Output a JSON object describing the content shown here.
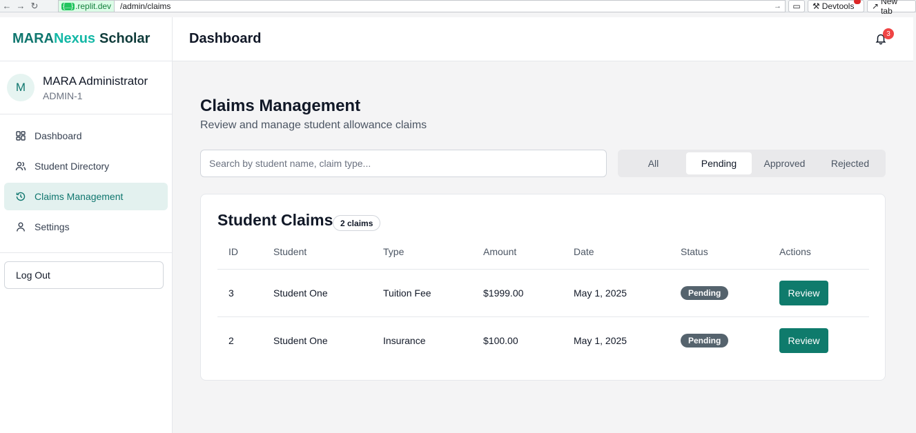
{
  "browser": {
    "host_badge": "{...}",
    "host": ".replit.dev",
    "path": "/admin/claims",
    "devtools_label": "Devtools",
    "new_tab_label": "New tab"
  },
  "sidebar": {
    "brand_part1": "MARA",
    "brand_part2": "Nexus",
    "brand_part3": "Scholar",
    "user": {
      "initial": "M",
      "name": "MARA Administrator",
      "id": "ADMIN-1"
    },
    "items": [
      {
        "label": "Dashboard",
        "icon": "dashboard-icon"
      },
      {
        "label": "Student Directory",
        "icon": "users-icon"
      },
      {
        "label": "Claims Management",
        "icon": "history-icon",
        "active": true
      },
      {
        "label": "Settings",
        "icon": "user-icon"
      }
    ],
    "logout_label": "Log Out"
  },
  "header": {
    "title": "Dashboard",
    "notification_count": "3"
  },
  "main": {
    "title": "Claims Management",
    "subtitle": "Review and manage student allowance claims",
    "search_placeholder": "Search by student name, claim type...",
    "filters": [
      {
        "label": "All"
      },
      {
        "label": "Pending",
        "active": true
      },
      {
        "label": "Approved"
      },
      {
        "label": "Rejected"
      }
    ],
    "card": {
      "title": "Student Claims",
      "count_badge": "2 claims",
      "columns": [
        "ID",
        "Student",
        "Type",
        "Amount",
        "Date",
        "Status",
        "Actions"
      ],
      "rows": [
        {
          "id": "3",
          "student": "Student One",
          "type": "Tuition Fee",
          "amount": "$1999.00",
          "date": "May 1, 2025",
          "status": "Pending",
          "action": "Review"
        },
        {
          "id": "2",
          "student": "Student One",
          "type": "Insurance",
          "amount": "$100.00",
          "date": "May 1, 2025",
          "status": "Pending",
          "action": "Review"
        }
      ]
    }
  },
  "colors": {
    "accent": "#0f7b6c",
    "active_nav_bg": "#e3f1ef",
    "status_pill": "#55636d",
    "notification": "#ef4444"
  }
}
